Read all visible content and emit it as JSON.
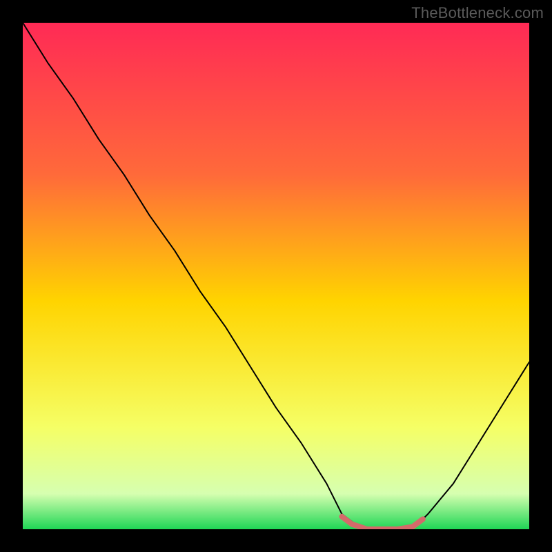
{
  "watermark": "TheBottleneck.com",
  "chart_data": {
    "type": "line",
    "title": "",
    "xlabel": "",
    "ylabel": "",
    "xlim": [
      0,
      100
    ],
    "ylim": [
      0,
      100
    ],
    "grid": false,
    "legend": false,
    "series": [
      {
        "name": "curve",
        "color": "#000000",
        "stroke_width": 2,
        "x": [
          0,
          5,
          10,
          15,
          20,
          25,
          30,
          35,
          40,
          45,
          50,
          55,
          60,
          63,
          67,
          71,
          75,
          77,
          80,
          85,
          90,
          95,
          100
        ],
        "y": [
          100,
          92,
          85,
          77,
          70,
          62,
          55,
          47,
          40,
          32,
          24,
          17,
          9,
          3,
          0,
          0,
          0,
          0,
          3,
          9,
          17,
          25,
          33
        ]
      },
      {
        "name": "highlight",
        "color": "#d46a6a",
        "stroke_width": 8,
        "x": [
          63,
          65,
          68,
          71,
          74,
          77,
          79
        ],
        "y": [
          2.5,
          1,
          0,
          0,
          0,
          0.5,
          2
        ]
      }
    ],
    "background_gradient": {
      "top": "#ff2a55",
      "mid_upper": "#ff6a3a",
      "mid": "#ffd400",
      "mid_lower": "#f5ff66",
      "green_band_top": "#d6ffb0",
      "bottom": "#1fd655"
    }
  }
}
